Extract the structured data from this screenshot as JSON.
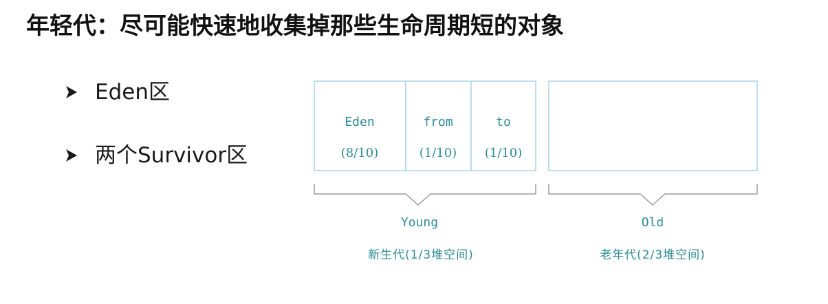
{
  "title": "年轻代：尽可能快速地收集掉那些生命周期短的对象",
  "bullets": [
    {
      "text": "Eden区",
      "icon": "arrow-bullet-icon"
    },
    {
      "text": "两个Survivor区",
      "icon": "arrow-bullet-icon"
    }
  ],
  "diagram": {
    "young": {
      "cells": [
        {
          "name": "Eden",
          "ratio": "(8/10)"
        },
        {
          "name": "from",
          "ratio": "(1/10)"
        },
        {
          "name": "to",
          "ratio": "(1/10)"
        }
      ],
      "label": "Young",
      "sublabel": "新生代(1/3堆空间)"
    },
    "old": {
      "label": "Old",
      "sublabel": "老年代(2/3堆空间)"
    }
  },
  "colors": {
    "box_border": "#a9d3e8",
    "box_text": "#2c8c95",
    "brace": "#9a9a9a",
    "title": "#111111"
  }
}
